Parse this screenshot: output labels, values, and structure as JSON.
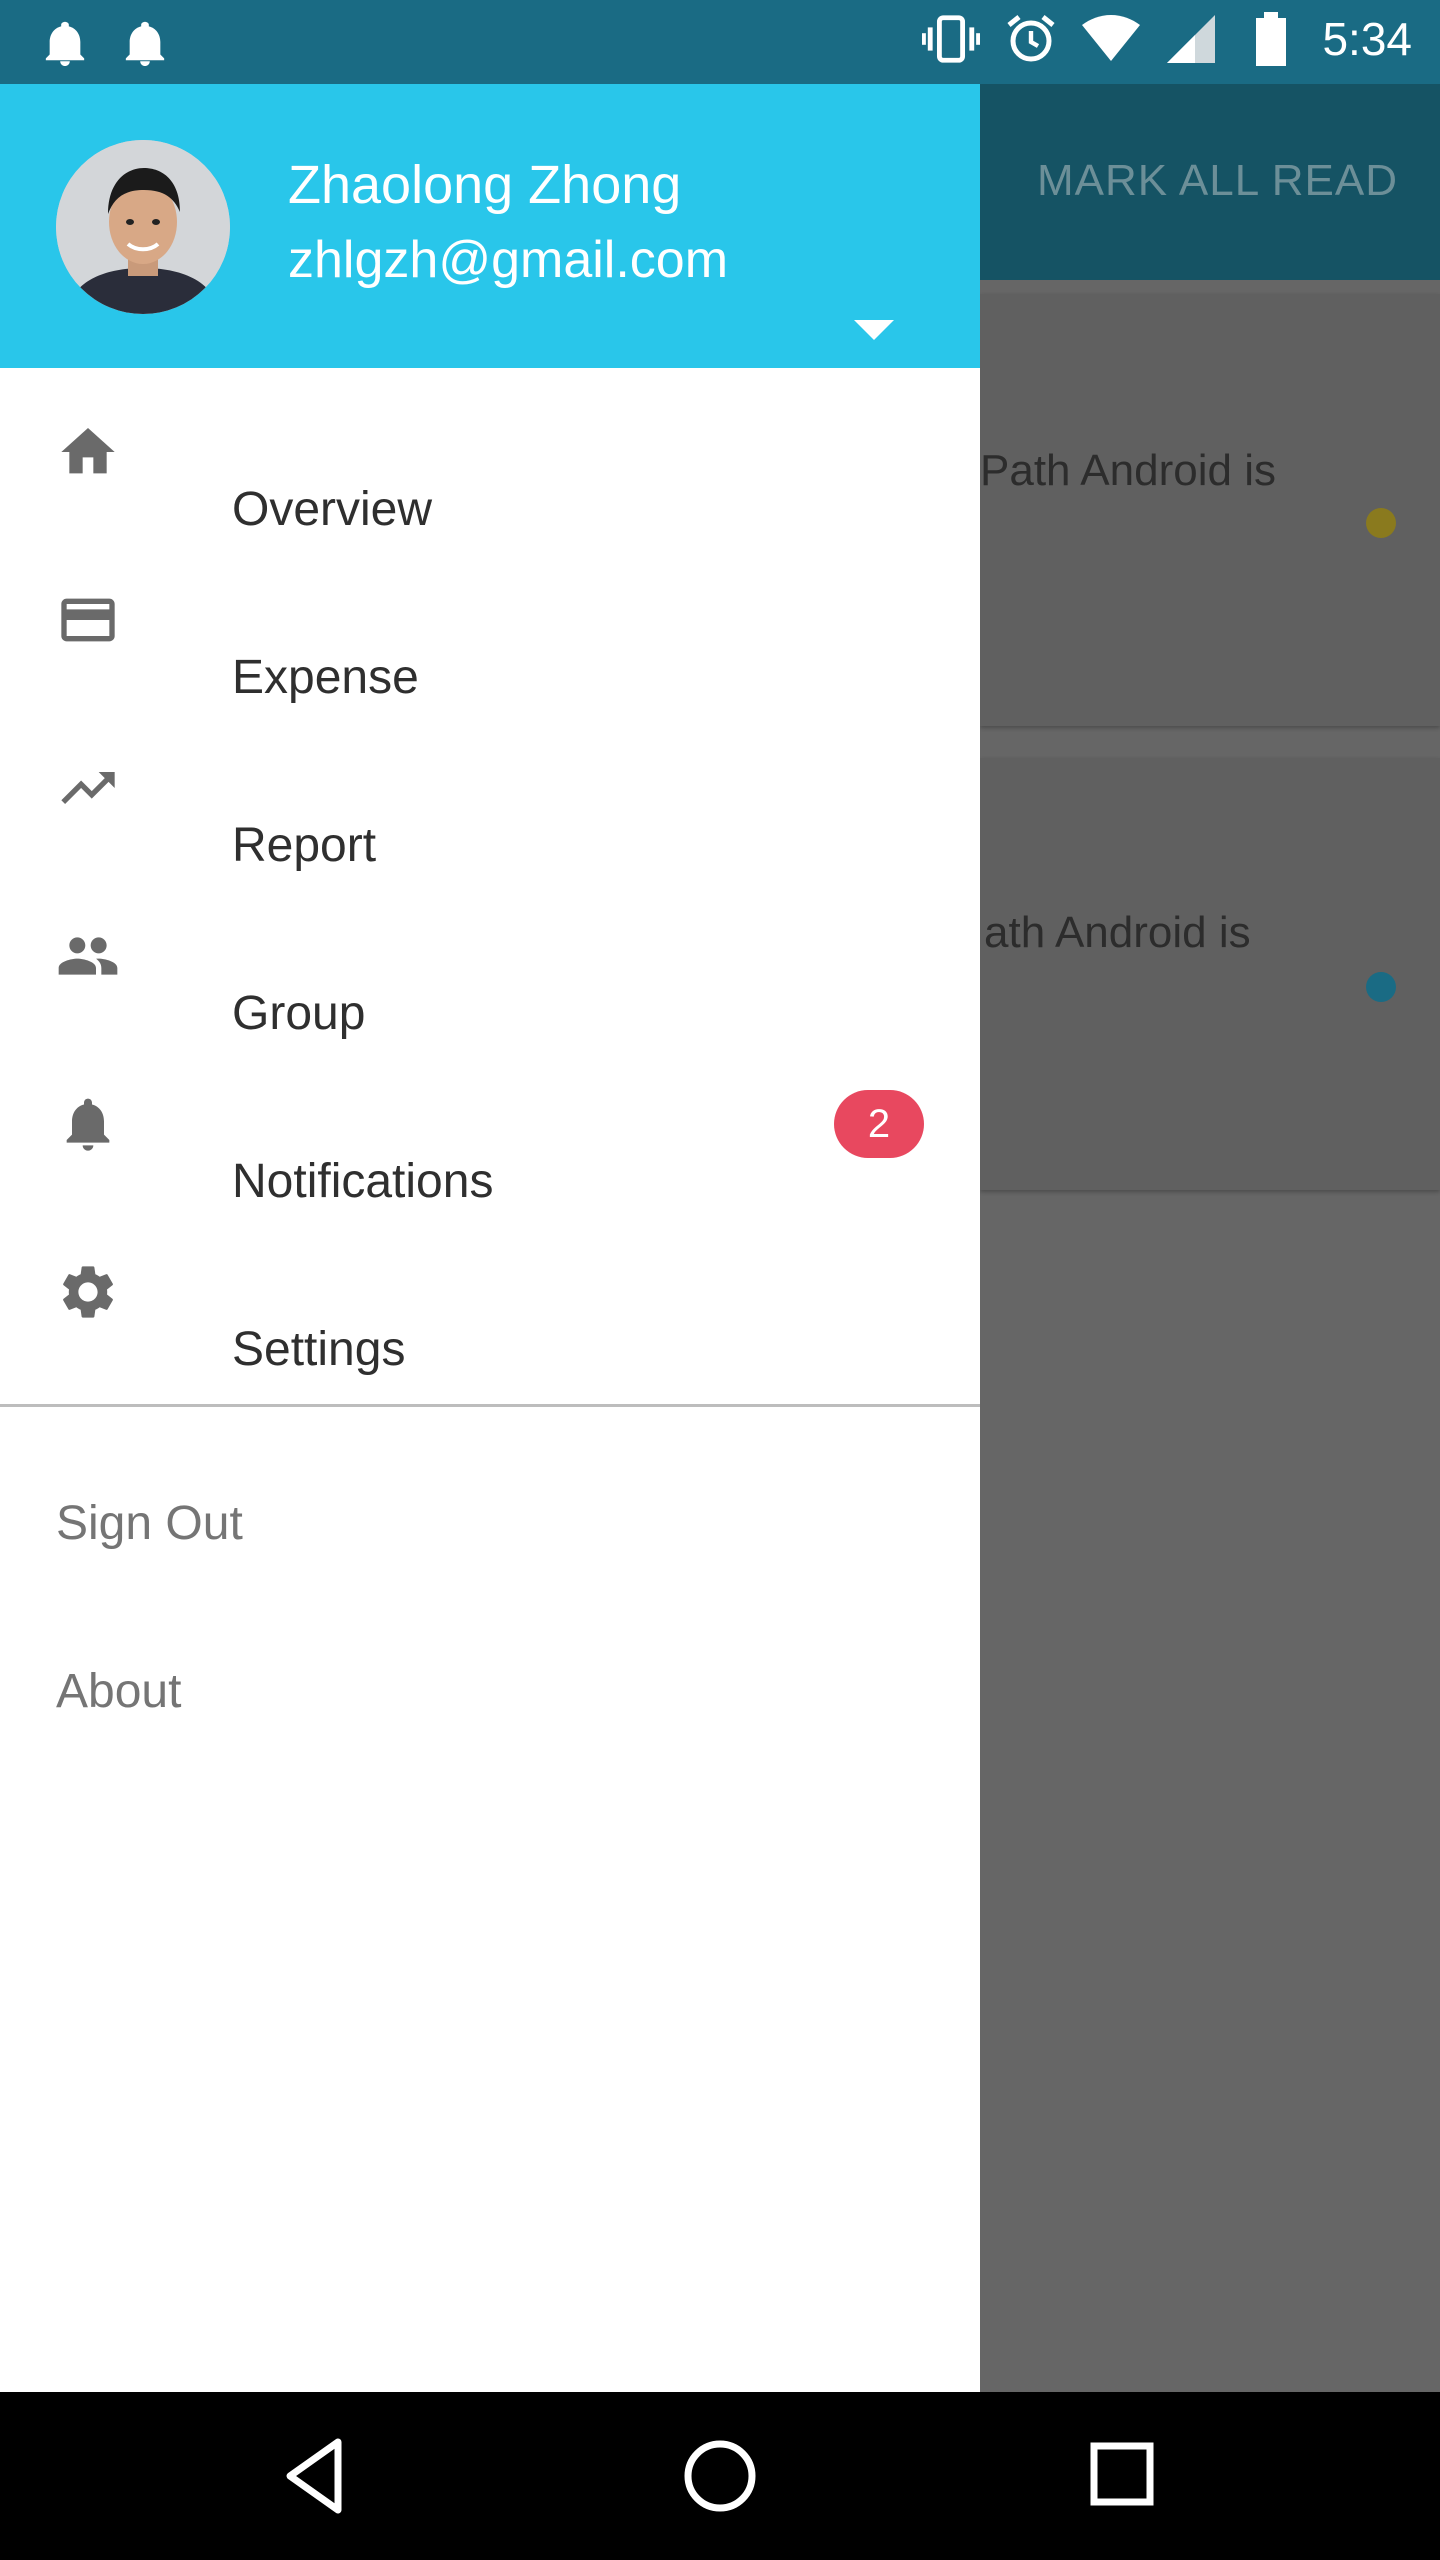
{
  "status_bar": {
    "time": "5:34",
    "left_icons": [
      "notification-bell-icon",
      "notification-bell-icon"
    ],
    "right_icons": [
      "vibrate-icon",
      "alarm-icon",
      "wifi-icon",
      "cellular-signal-icon",
      "battery-icon"
    ]
  },
  "background_app": {
    "toolbar_action": "MARK ALL READ",
    "cards": [
      {
        "text": "Path Android is",
        "dot_color": "#8a7a1e"
      },
      {
        "text": "ath Android is",
        "dot_color": "#1a6b84"
      }
    ]
  },
  "drawer": {
    "header": {
      "name": "Zhaolong Zhong",
      "email": "zhlgzh@gmail.com",
      "background_color": "#29c6ea"
    },
    "menu": [
      {
        "label": "Overview",
        "icon": "home-icon"
      },
      {
        "label": "Expense",
        "icon": "credit-card-icon"
      },
      {
        "label": "Report",
        "icon": "trending-up-icon"
      },
      {
        "label": "Group",
        "icon": "group-icon"
      },
      {
        "label": "Notifications",
        "icon": "bell-icon",
        "badge": "2"
      },
      {
        "label": "Settings",
        "icon": "gear-icon"
      }
    ],
    "secondary": [
      {
        "label": "Sign Out"
      },
      {
        "label": "About"
      }
    ],
    "badge_color": "#e8485f"
  },
  "nav_bar": {
    "buttons": [
      "back-icon",
      "home-circle-icon",
      "recents-icon"
    ]
  }
}
